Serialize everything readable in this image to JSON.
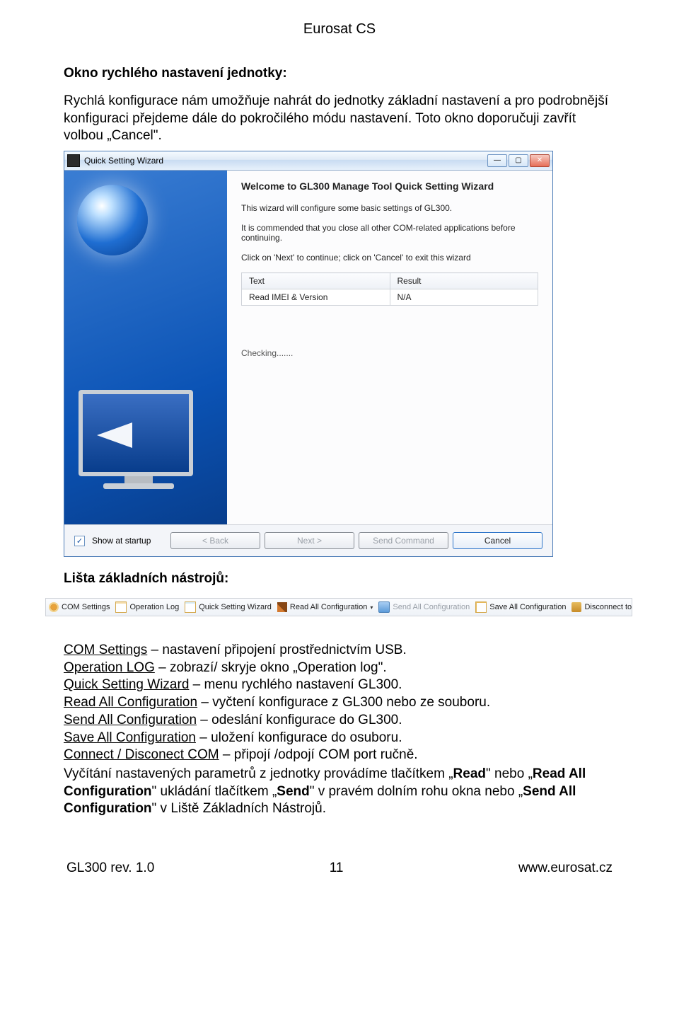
{
  "header": {
    "company": "Eurosat CS"
  },
  "s1": {
    "heading": "Okno rychlého nastavení jednotky:",
    "text": "Rychlá konfigurace nám umožňuje nahrát do jednotky základní nastavení a pro podrobnější konfiguraci přejdeme dále do pokročilého módu nastavení. Toto okno doporučuji zavřít volbou „Cancel\"."
  },
  "wizard": {
    "title": "Quick Setting Wizard",
    "welcome": "Welcome to GL300 Manage Tool  Quick Setting Wizard",
    "line1": "This wizard will configure some basic settings of GL300.",
    "line2": "It is commended that you close all other COM-related applications before continuing.",
    "line3": "Click on 'Next' to continue; click on 'Cancel' to exit this wizard",
    "table": {
      "h1": "Text",
      "h2": "Result",
      "r1c1": "Read IMEI & Version",
      "r1c2": "N/A"
    },
    "checking": "Checking.......",
    "show_at_startup": "Show at startup",
    "back": "< Back",
    "next": "Next >",
    "send": "Send Command",
    "cancel": "Cancel"
  },
  "s2": {
    "heading": "Lišta základních nástrojů:"
  },
  "toolbar": {
    "com": "COM Settings",
    "log": "Operation Log",
    "quick": "Quick Setting Wizard",
    "readall": "Read All Configuration",
    "sendall": "Send All Configuration",
    "saveall": "Save All Configuration",
    "disconnect": "Disconnect to COM"
  },
  "links": {
    "com": "COM Settings",
    "com_d": " – nastavení připojení prostřednictvím USB.",
    "log": "Operation LOG",
    "log_d": " – zobrazí/ skryje okno „Operation log\".",
    "quick": "Quick Setting Wizard",
    "quick_d": " – menu rychlého nastavení GL300.",
    "readall": "Read All Configuration",
    "readall_d": " – vyčtení konfigurace z GL300 nebo ze souboru.",
    "sendall": "Send All Configuration",
    "sendall_d": " – odeslání konfigurace do GL300.",
    "saveall": "Save All Configuration",
    "saveall_d": " – uložení konfigurace do osuboru.",
    "connect": "Connect / Disconect COM",
    "connect_d": " – připojí /odpojí COM port ručně."
  },
  "para": {
    "p1a": "Vyčítání nastavených parametrů z jednotky provádíme tlačítkem „",
    "p1b": "Read",
    "p1c": "\" nebo „",
    "p1d": "Read All Configuration",
    "p1e": "\" ukládání tlačítkem „",
    "p1f": "Send",
    "p1g": "\" v pravém dolním rohu okna nebo „",
    "p1h": "Send All Configuration",
    "p1i": "\" v Liště Základních Nástrojů."
  },
  "footer": {
    "left": "GL300 rev. 1.0",
    "center": "11",
    "right": "www.eurosat.cz"
  }
}
